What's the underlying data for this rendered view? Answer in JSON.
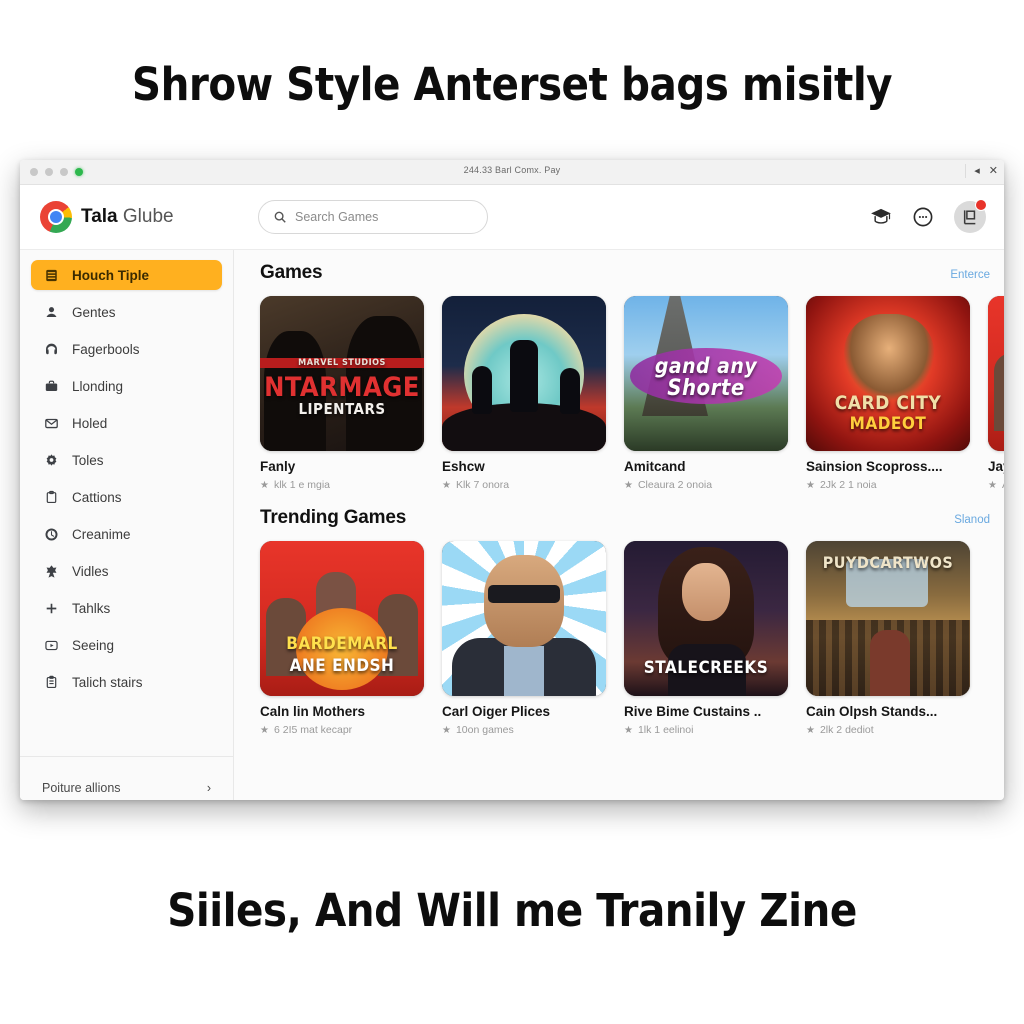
{
  "captions": {
    "top": "Shrow Style Anterset bags misitly",
    "bottom": "Siiles, And Will me Tranily Zine"
  },
  "window": {
    "title": "244.33 Barl Comx. Pay",
    "controls": {
      "minimize": "◂",
      "close": "✕"
    }
  },
  "toolbar": {
    "brand_bold": "Tala",
    "brand_light": "Glube",
    "search_placeholder": "Search Games",
    "search_value": "",
    "icons": [
      "graduation-cap-icon",
      "more-circle-icon",
      "profile-badge-icon"
    ]
  },
  "sidebar": {
    "items": [
      {
        "label": "Houch Tiple",
        "icon": "library-icon",
        "active": true
      },
      {
        "label": "Gentes",
        "icon": "user-icon",
        "active": false
      },
      {
        "label": "Fagerbools",
        "icon": "headphones-icon",
        "active": false
      },
      {
        "label": "Llonding",
        "icon": "briefcase-icon",
        "active": false
      },
      {
        "label": "Holed",
        "icon": "mail-icon",
        "active": false
      },
      {
        "label": "Toles",
        "icon": "gear-icon",
        "active": false
      },
      {
        "label": "Cattions",
        "icon": "clipboard-icon",
        "active": false
      },
      {
        "label": "Creanime",
        "icon": "clock-icon",
        "active": false
      },
      {
        "label": "Vidles",
        "icon": "award-icon",
        "active": false
      },
      {
        "label": "Tahlks",
        "icon": "plus-icon",
        "active": false
      },
      {
        "label": "Seeing",
        "icon": "play-box-icon",
        "active": false
      },
      {
        "label": "Talich stairs",
        "icon": "notes-icon",
        "active": false
      }
    ],
    "footer": {
      "label": "Poiture allions",
      "chevron": "›"
    }
  },
  "sections": [
    {
      "title": "Games",
      "link": "Enterce",
      "cards": [
        {
          "title": "Fanly",
          "subtitle": "klk 1 e mgia",
          "art": "a1",
          "art_text": {
            "small": "MARVEL STUDIOS",
            "main": "NTARMAGE",
            "sub": "LIPENTARS"
          }
        },
        {
          "title": "Eshcw",
          "subtitle": "Klk 7 onora",
          "art": "a2",
          "art_text": {
            "small": "",
            "main": "",
            "sub": ""
          }
        },
        {
          "title": "Amitcand",
          "subtitle": "Cleaura 2 onoia",
          "art": "a3",
          "art_text": {
            "small": "",
            "main": "gand any",
            "sub": "Shorte"
          }
        },
        {
          "title": "Sainsion Scopross....",
          "subtitle": "2Jk 2 1 noia",
          "art": "a4",
          "art_text": {
            "small": "",
            "main": "CARD CITY",
            "sub": "MADEOT"
          }
        },
        {
          "title": "Jay",
          "subtitle": "Al",
          "art": "a5",
          "art_text": {
            "small": "",
            "main": "",
            "sub": ""
          }
        }
      ]
    },
    {
      "title": "Trending Games",
      "link": "Slanod",
      "cards": [
        {
          "title": "Caln lin Mothers",
          "subtitle": "6 2I5 mat kecapr",
          "art": "a5",
          "art_text": {
            "small": "",
            "main": "BARDEMARL",
            "sub": "ANE ENDSH"
          }
        },
        {
          "title": "Carl Oiger Plices",
          "subtitle": "10on games",
          "art": "a6",
          "art_text": {
            "small": "",
            "main": "",
            "sub": ""
          }
        },
        {
          "title": "Rive Bime Custains ..",
          "subtitle": "1lk 1 eelinoi",
          "art": "a7",
          "art_text": {
            "small": "",
            "main": "STALECREEKS",
            "sub": ""
          }
        },
        {
          "title": "Cain Olpsh Stands...",
          "subtitle": "2lk 2 dediot",
          "art": "a8",
          "art_text": {
            "small": "",
            "main": "PUYDCARTWOS",
            "sub": ""
          }
        }
      ]
    }
  ],
  "colors": {
    "accent": "#ffb01f",
    "link": "#6aa9e0",
    "badge": "#e8332a",
    "window_bg": "#ffffff"
  }
}
